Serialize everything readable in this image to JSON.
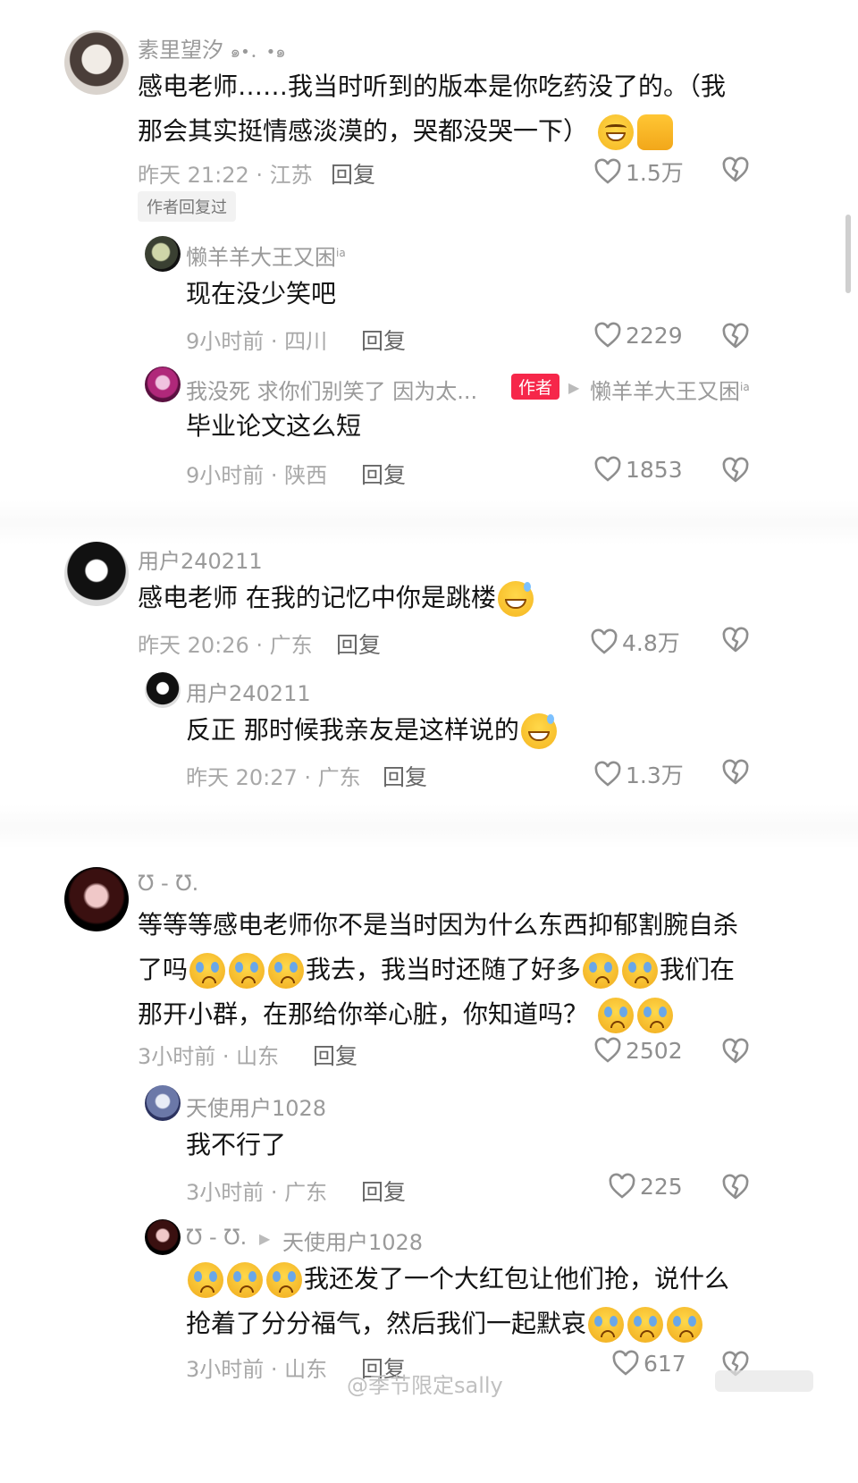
{
  "comments": [
    {
      "username": "素里望汐",
      "username_suffix": "๑•．•๑",
      "text_line1": "感电老师……我当时听到的版本是你吃药没了的。（我",
      "text_line2": "那会其实挺情感淡漠的，哭都没哭一下）",
      "time": "昨天 21:22 · 江苏",
      "reply": "回复",
      "likes": "1.5万",
      "author_replied": "作者回复过"
    },
    {
      "username": "懒羊羊大王又困",
      "username_sup": "ia",
      "text": "现在没少笑吧",
      "time": "9小时前 · 四川",
      "reply": "回复",
      "likes": "2229"
    },
    {
      "username": "我没死 求你们别笑了 因为太...",
      "author_badge": "作者",
      "reply_to": "懒羊羊大王又困",
      "reply_to_sup": "ia",
      "text": "毕业论文这么短",
      "time": "9小时前 · 陕西",
      "reply": "回复",
      "likes": "1853"
    },
    {
      "username": "用户240211",
      "text": "感电老师 在我的记忆中你是跳楼",
      "time": "昨天 20:26 · 广东",
      "reply": "回复",
      "likes": "4.8万"
    },
    {
      "username": "用户240211",
      "text": "反正 那时候我亲友是这样说的",
      "time": "昨天 20:27 · 广东",
      "reply": "回复",
      "likes": "1.3万"
    },
    {
      "username": "Ʊ - Ʊ.",
      "text_line1": "等等等感电老师你不是当时因为什么东西抑郁割腕自杀",
      "text_line2a": "了吗",
      "text_line2b": "我去，我当时还随了好多",
      "text_line2c": "我们在",
      "text_line3": "那开小群，在那给你举心脏，你知道吗？",
      "time": "3小时前 · 山东",
      "reply": "回复",
      "likes": "2502"
    },
    {
      "username": "天使用户1028",
      "text": "我不行了",
      "time": "3小时前 · 广东",
      "reply": "回复",
      "likes": "225"
    },
    {
      "username": "Ʊ - Ʊ.",
      "reply_to": "天使用户1028",
      "text_line1": "我还发了一个大红包让他们抢，说什么",
      "text_line2": "抢着了分分福气，然后我们一起默哀",
      "time": "3小时前 · 山东",
      "reply": "回复",
      "likes": "617"
    }
  ],
  "watermark": "@季节限定sally",
  "colors": {
    "author_badge": "#f6274a",
    "meta": "#a8a8a8",
    "text": "#141414"
  },
  "icons": {
    "like": "heart-outline-icon",
    "dislike": "broken-heart-icon"
  }
}
